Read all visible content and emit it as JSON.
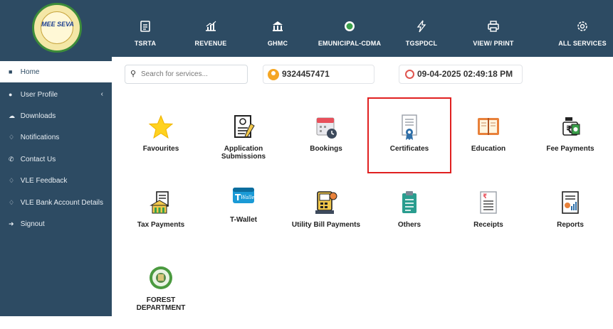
{
  "header": {
    "logo_text": "MEE SEVA",
    "nav": [
      {
        "label": "TSRTA",
        "icon": "clipboard-icon"
      },
      {
        "label": "REVENUE",
        "icon": "chart-icon"
      },
      {
        "label": "GHMC",
        "icon": "building-icon"
      },
      {
        "label": "EMUNICIPAL-CDMA",
        "icon": "globe-icon"
      },
      {
        "label": "TGSPDCL",
        "icon": "lightning-icon"
      },
      {
        "label": "VIEW/ PRINT",
        "icon": "printer-icon"
      },
      {
        "label": "ALL SERVICES",
        "icon": "gear-icon"
      }
    ]
  },
  "sidebar": {
    "items": [
      {
        "label": "Home",
        "icon": "home-icon"
      },
      {
        "label": "User Profile",
        "icon": "user-icon"
      },
      {
        "label": "Downloads",
        "icon": "cloud-download-icon"
      },
      {
        "label": "Notifications",
        "icon": "bell-icon"
      },
      {
        "label": "Contact Us",
        "icon": "phone-icon"
      },
      {
        "label": "VLE Feedback",
        "icon": "bell-icon"
      },
      {
        "label": "VLE Bank Account Details",
        "icon": "bell-icon"
      },
      {
        "label": "Signout",
        "icon": "signout-icon"
      }
    ],
    "chevron": "‹"
  },
  "toolbar": {
    "search_placeholder": "Search for services...",
    "phone": "9324457471",
    "datetime": "09-04-2025 02:49:18 PM"
  },
  "tiles": [
    {
      "label": "Favourites",
      "icon": "star-icon"
    },
    {
      "label": "Application Submissions",
      "icon": "application-icon"
    },
    {
      "label": "Bookings",
      "icon": "calendar-icon"
    },
    {
      "label": "Certificates",
      "icon": "certificate-icon"
    },
    {
      "label": "Education",
      "icon": "book-icon"
    },
    {
      "label": "Fee Payments",
      "icon": "fee-payment-icon"
    },
    {
      "label": "Tax Payments",
      "icon": "tax-building-icon"
    },
    {
      "label": "T-Wallet",
      "icon": "wallet-icon"
    },
    {
      "label": "Utility Bill Payments",
      "icon": "bill-machine-icon"
    },
    {
      "label": "Others",
      "icon": "clipboard-icon"
    },
    {
      "label": "Receipts",
      "icon": "receipt-icon"
    },
    {
      "label": "Reports",
      "icon": "report-icon"
    },
    {
      "label": "FOREST DEPARTMENT",
      "icon": "forest-seal-icon"
    }
  ]
}
